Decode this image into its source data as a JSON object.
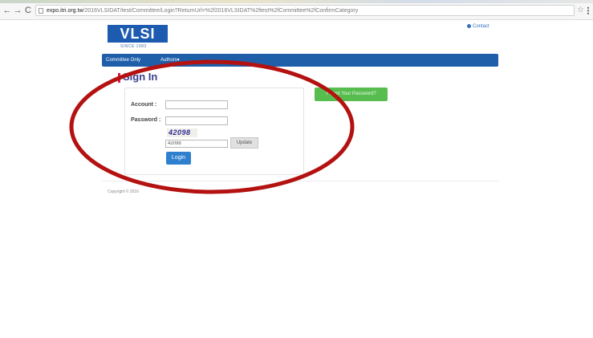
{
  "browser": {
    "url_host": "expo.itri.org.tw",
    "url_rest": "/2016VLSIDAT/test/Committee/Login?ReturnUrl=%2f2016VLSIDAT%2ftest%2fCommittee%2fConfirmCategory",
    "back_icon": "←",
    "forward_icon": "→",
    "reload_icon": "C",
    "star_icon": "☆"
  },
  "header": {
    "logo_text": "VLSI",
    "logo_sub": "SINCE 1983",
    "contact_label": "Contact"
  },
  "nav": {
    "items": [
      "Committee Only",
      "Authors▾"
    ]
  },
  "signin": {
    "title": "Sign In",
    "account_label": "Account :",
    "account_value": "",
    "password_label": "Password :",
    "password_value": "",
    "captcha_text": "42098",
    "captcha_input_value": "42098",
    "update_label": "Update",
    "login_label": "Login"
  },
  "forgot_label": "Forgot Your Password?",
  "footer": {
    "copyright": "Copyright © 2016"
  },
  "colors": {
    "brand_blue": "#1f5faa",
    "forgot_green": "#58bd4f",
    "annotation_red": "#b41111"
  }
}
